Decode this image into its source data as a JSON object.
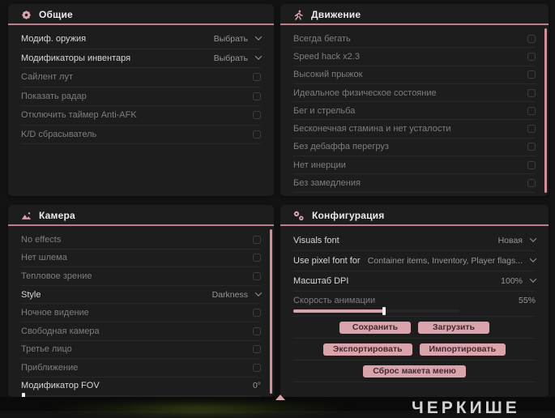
{
  "colors": {
    "accent": "#dba3ac",
    "header_line": "#bb8089",
    "page_bg": "#131313",
    "panel_bg": "#1d1d1e",
    "label_on": "#d8d8d8",
    "label_off": "#7e7e7e",
    "value": "#979797",
    "divider": "#28282a",
    "checkbox_border": "#3d3d3f",
    "scrollbar": "#d08f99",
    "button_text": "#432930",
    "slider_handle": "#f0f0f0"
  },
  "watermark": "ЧЕРКИШЕ",
  "panels": [
    {
      "id": "general",
      "title": "Общие",
      "icon": "gear-icon",
      "scrollbar": false,
      "rows": [
        {
          "type": "dropdown",
          "label": "Модиф. оружия",
          "value": "Выбрать",
          "enabled": true
        },
        {
          "type": "dropdown",
          "label": "Модификаторы инвентаря",
          "value": "Выбрать",
          "enabled": true
        },
        {
          "type": "checkbox",
          "label": "Сайлент лут",
          "checked": false,
          "enabled": false
        },
        {
          "type": "checkbox",
          "label": "Показать радар",
          "checked": false,
          "enabled": false
        },
        {
          "type": "checkbox",
          "label": "Отключить таймер Anti-AFK",
          "checked": false,
          "enabled": false
        },
        {
          "type": "checkbox",
          "label": "K/D сбрасыватель",
          "checked": false,
          "enabled": false
        }
      ]
    },
    {
      "id": "movement",
      "title": "Движение",
      "icon": "runner-icon",
      "scrollbar": true,
      "rows": [
        {
          "type": "checkbox",
          "label": "Всегда бегать",
          "checked": false,
          "enabled": false
        },
        {
          "type": "checkbox",
          "label": "Speed hack x2.3",
          "checked": false,
          "enabled": false
        },
        {
          "type": "checkbox",
          "label": "Высокий прыжок",
          "checked": false,
          "enabled": false
        },
        {
          "type": "checkbox",
          "label": "Идеальное физическое состояние",
          "checked": false,
          "enabled": false
        },
        {
          "type": "checkbox",
          "label": "Бег и стрельба",
          "checked": false,
          "enabled": false
        },
        {
          "type": "checkbox",
          "label": "Бесконечная стамина и нет усталости",
          "checked": false,
          "enabled": false
        },
        {
          "type": "checkbox",
          "label": "Без дебаффа перегруз",
          "checked": false,
          "enabled": false
        },
        {
          "type": "checkbox",
          "label": "Нет инерции",
          "checked": false,
          "enabled": false
        },
        {
          "type": "checkbox",
          "label": "Без замедления",
          "checked": false,
          "enabled": false
        }
      ]
    },
    {
      "id": "camera",
      "title": "Камера",
      "icon": "image-icon",
      "scrollbar": true,
      "rows": [
        {
          "type": "checkbox",
          "label": "No effects",
          "checked": false,
          "enabled": false
        },
        {
          "type": "checkbox",
          "label": "Нет шлема",
          "checked": false,
          "enabled": false
        },
        {
          "type": "checkbox",
          "label": "Тепловое зрение",
          "checked": false,
          "enabled": false
        },
        {
          "type": "dropdown",
          "label": "Style",
          "value": "Darkness",
          "enabled": true
        },
        {
          "type": "checkbox",
          "label": "Ночное видение",
          "checked": false,
          "enabled": false
        },
        {
          "type": "checkbox",
          "label": "Свободная камера",
          "checked": false,
          "enabled": false
        },
        {
          "type": "checkbox",
          "label": "Третье лицо",
          "checked": false,
          "enabled": false
        },
        {
          "type": "checkbox",
          "label": "Приближение",
          "checked": false,
          "enabled": false
        },
        {
          "type": "slider",
          "label": "Модификатор FOV",
          "value": "0°",
          "percent": 0,
          "enabled": true
        }
      ]
    },
    {
      "id": "config",
      "title": "Конфигурация",
      "icon": "gears-icon",
      "scrollbar": false,
      "rows": [
        {
          "type": "dropdown",
          "label": "Visuals font",
          "value": "Новая",
          "enabled": true
        },
        {
          "type": "dropdown",
          "label": "Use pixel font for",
          "value": "Container items, Inventory, Player flags...",
          "enabled": true
        },
        {
          "type": "dropdown",
          "label": "Масштаб DPI",
          "value": "100%",
          "enabled": true
        },
        {
          "type": "slider",
          "label": "Скорость анимации",
          "value": "55%",
          "percent": 55,
          "enabled": false
        },
        {
          "type": "buttons",
          "items": [
            "Сохранить",
            "Загрузить"
          ]
        },
        {
          "type": "buttons",
          "items": [
            "Экспортировать",
            "Импортировать"
          ]
        },
        {
          "type": "buttons",
          "items": [
            "Сброс макета меню"
          ]
        }
      ]
    }
  ]
}
